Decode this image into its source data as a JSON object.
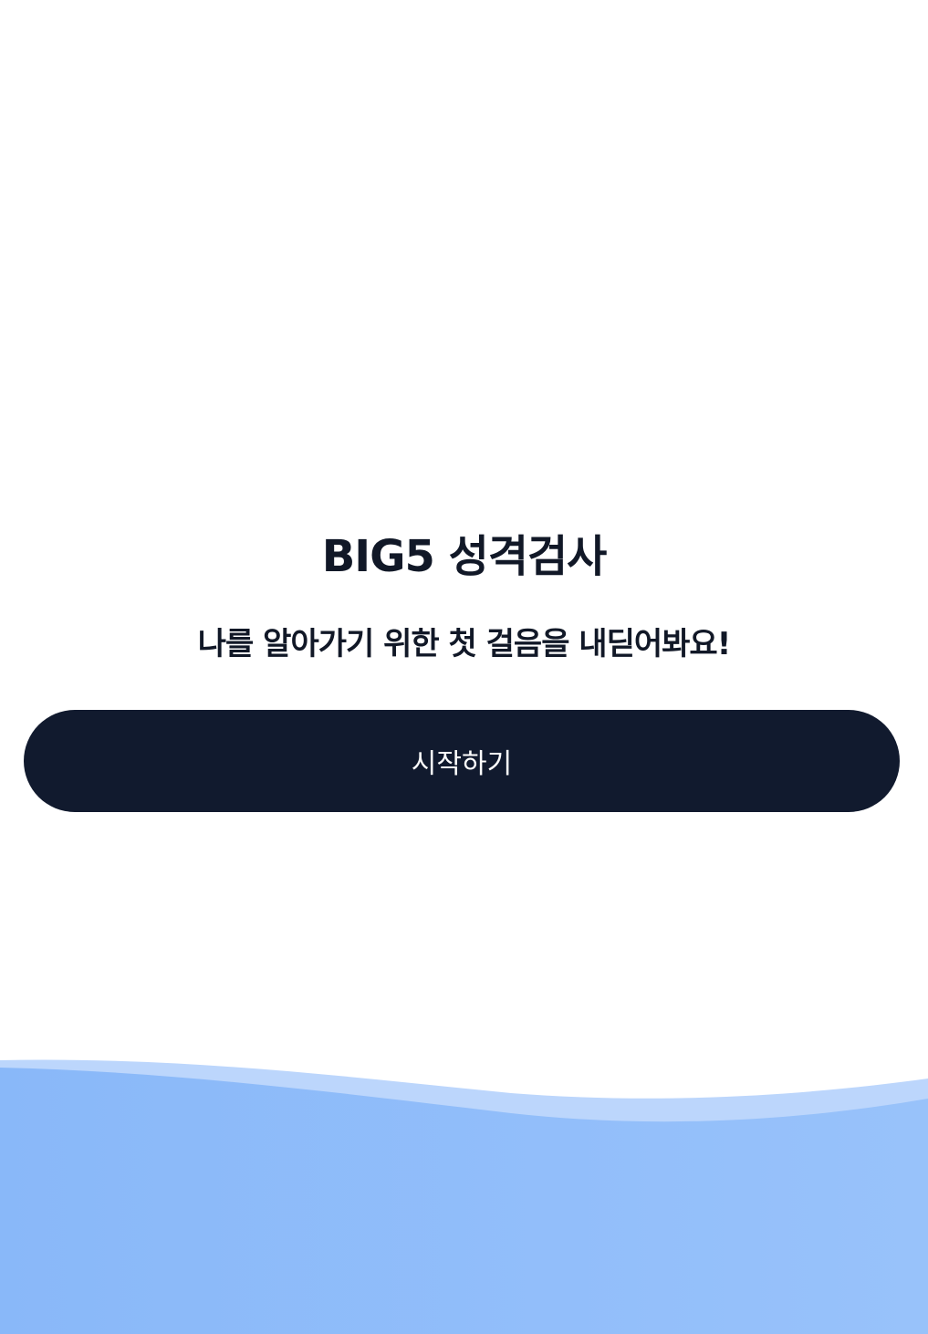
{
  "title": "BIG5 성격검사",
  "subtitle": "나를 알아가기 위한 첫 걸음을 내딛어봐요!",
  "start_button_label": "시작하기",
  "colors": {
    "background": "#ffffff",
    "text": "#111827",
    "button": "#111a2e",
    "button_text": "#ffffff",
    "wave_light": "#b6d1fb",
    "wave_main": "#8db9f9"
  }
}
